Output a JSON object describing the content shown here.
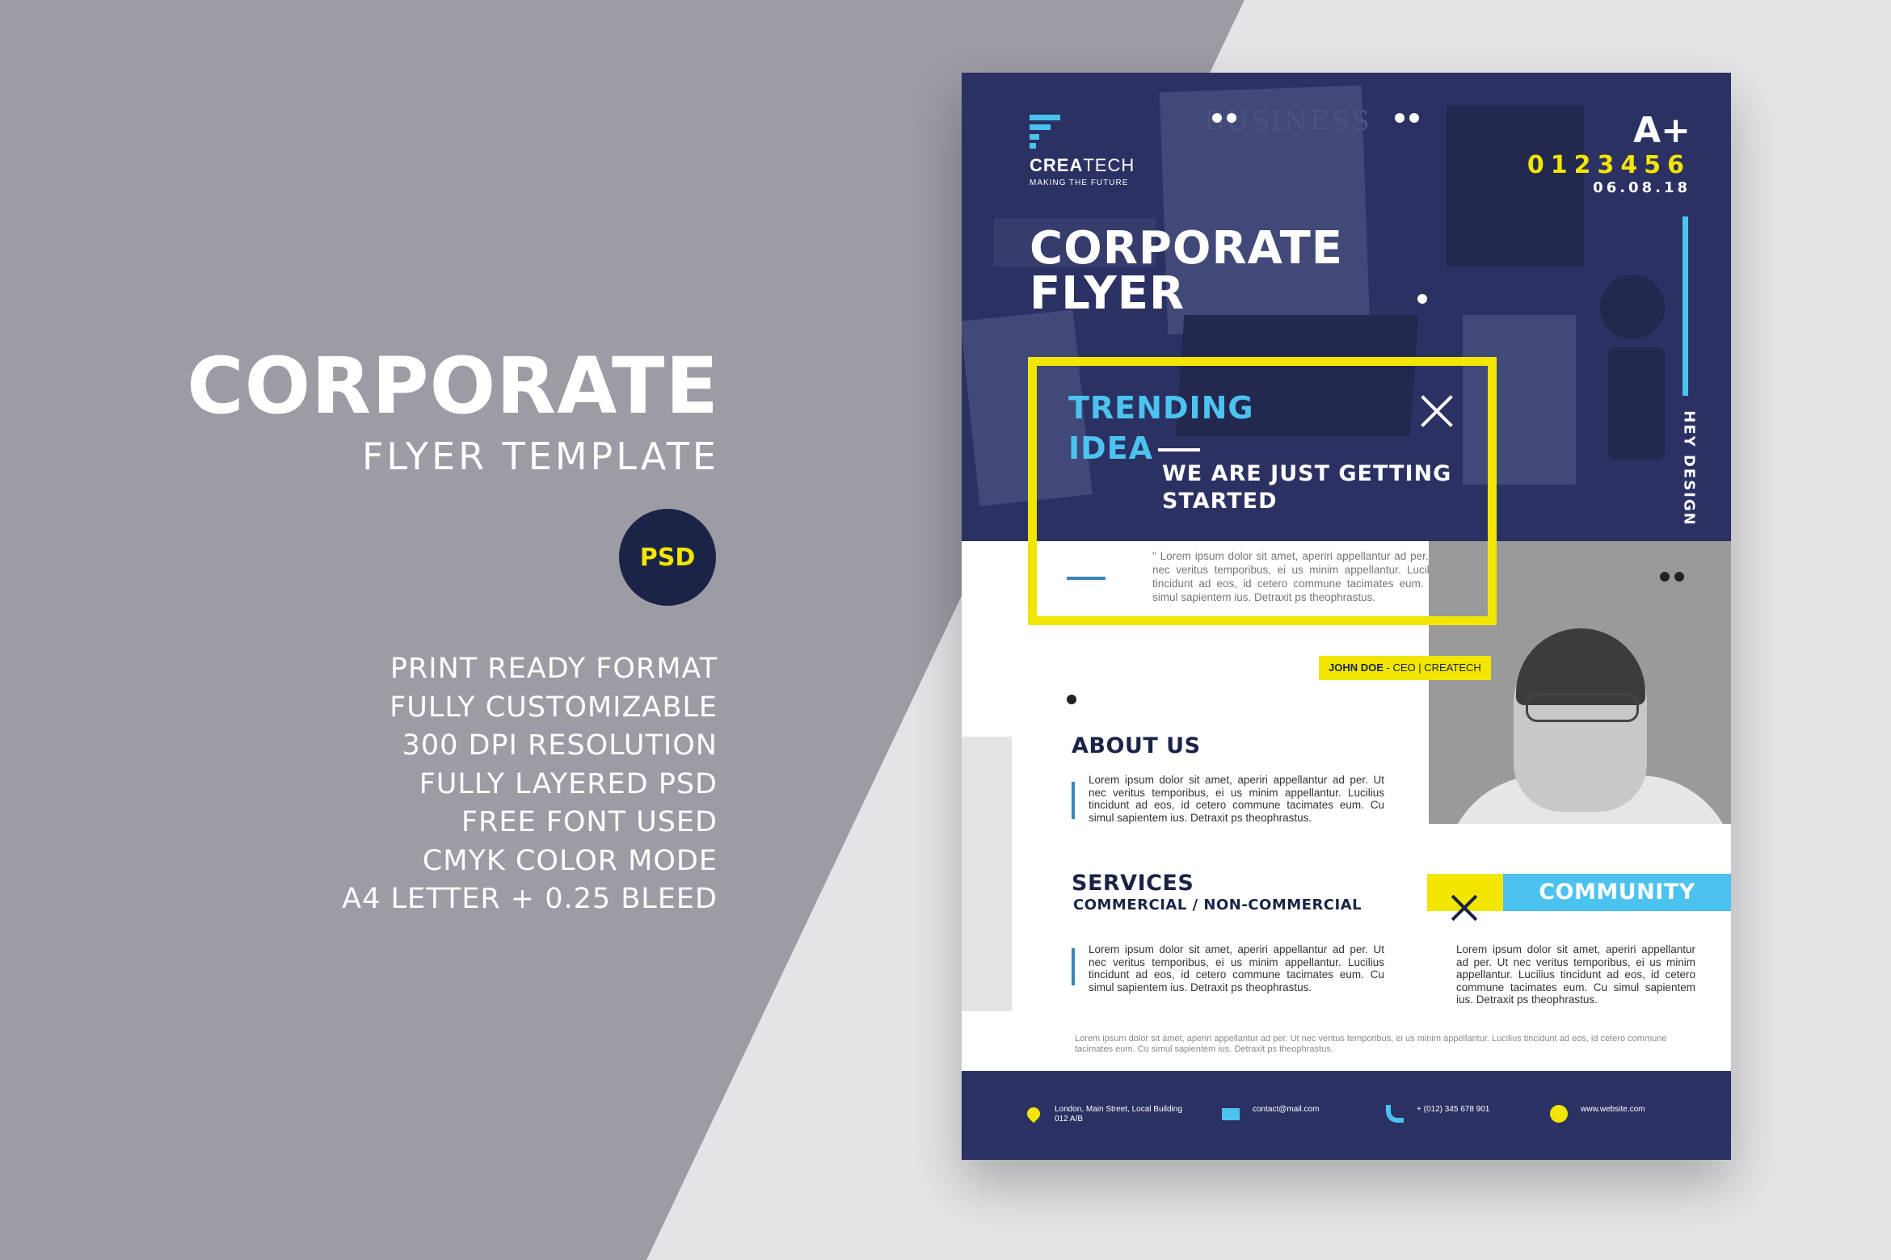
{
  "left_panel": {
    "title": "CORPORATE",
    "subtitle": "FLYER TEMPLATE",
    "badge": "PSD",
    "features": [
      "PRINT READY FORMAT",
      "FULLY CUSTOMIZABLE",
      "300 DPI RESOLUTION",
      "FULLY LAYERED PSD",
      "FREE FONT USED",
      "CMYK COLOR MODE",
      "A4 LETTER + 0.25 BLEED"
    ]
  },
  "flyer": {
    "photo_word": "BUSINESS",
    "logo": {
      "name_bold": "CREA",
      "name_regular": "TECH",
      "tagline": "MAKING THE FUTURE"
    },
    "grade": "A+",
    "number": "0123456",
    "date": "06.08.18",
    "side_label": "HEY DESIGN",
    "title_line1": "CORPORATE",
    "title_line2": "FLYER",
    "trending_line1": "TRENDING",
    "trending_line2": "IDEA",
    "started_line1": "WE ARE JUST GETTING",
    "started_line2": "STARTED",
    "quote": "\" Lorem ipsum dolor sit amet, aperiri appellantur ad per. Ut nec veritus temporibus, ei us minim appellantur. Lucilius tincidunt ad eos, id cetero commune tacimates eum. Cu simul sapientem ius. Detraxit ps theophrastus.",
    "name_tag": {
      "name": "JOHN DOE",
      "role": " - CEO | CREATECH"
    },
    "about": {
      "title": "ABOUT US",
      "text": "Lorem ipsum dolor sit amet, aperiri appellantur ad per. Ut nec veritus temporibus, ei us minim appellantur. Lucilius tincidunt ad eos, id cetero commune tacimates eum. Cu simul sapientem ius. Detraxit ps theophrastus."
    },
    "services": {
      "title": "SERVICES",
      "subtitle": "COMMERCIAL / NON-COMMERCIAL",
      "text": "Lorem ipsum dolor sit amet, aperiri appellantur ad per. Ut nec veritus temporibus, ei us minim appellantur. Lucilius tincidunt ad eos, id cetero commune tacimates eum. Cu simul sapientem ius. Detraxit ps theophrastus."
    },
    "community": {
      "title": "COMMUNITY",
      "text": "Lorem ipsum dolor sit amet, aperiri appellantur ad per. Ut nec veritus temporibus, ei us minim appellantur. Lucilius tincidunt ad eos, id cetero commune tacimates eum. Cu simul sapientem ius. Detraxit ps theophrastus."
    },
    "footnote": "Lorem ipsum dolor sit amet, aperiri appellantur ad per. Ut nec veritus temporibus, ei us minim appellantur. Lucilius tincidunt ad eos, id cetero commune tacimates eum. Cu simul sapientem ius. Detraxit ps theophrastus.",
    "footer": {
      "address_line1": "London, Main Street, Local Building",
      "address_line2": "012 A/B",
      "email": "contact@mail.com",
      "phone": "+ (012) 345 678 901",
      "website": "www.website.com"
    }
  },
  "colors": {
    "navy": "#2b3163",
    "dark_navy": "#1b2347",
    "yellow": "#f2e600",
    "cyan": "#4cc3ef",
    "gray_panel": "#9d9ba3"
  }
}
